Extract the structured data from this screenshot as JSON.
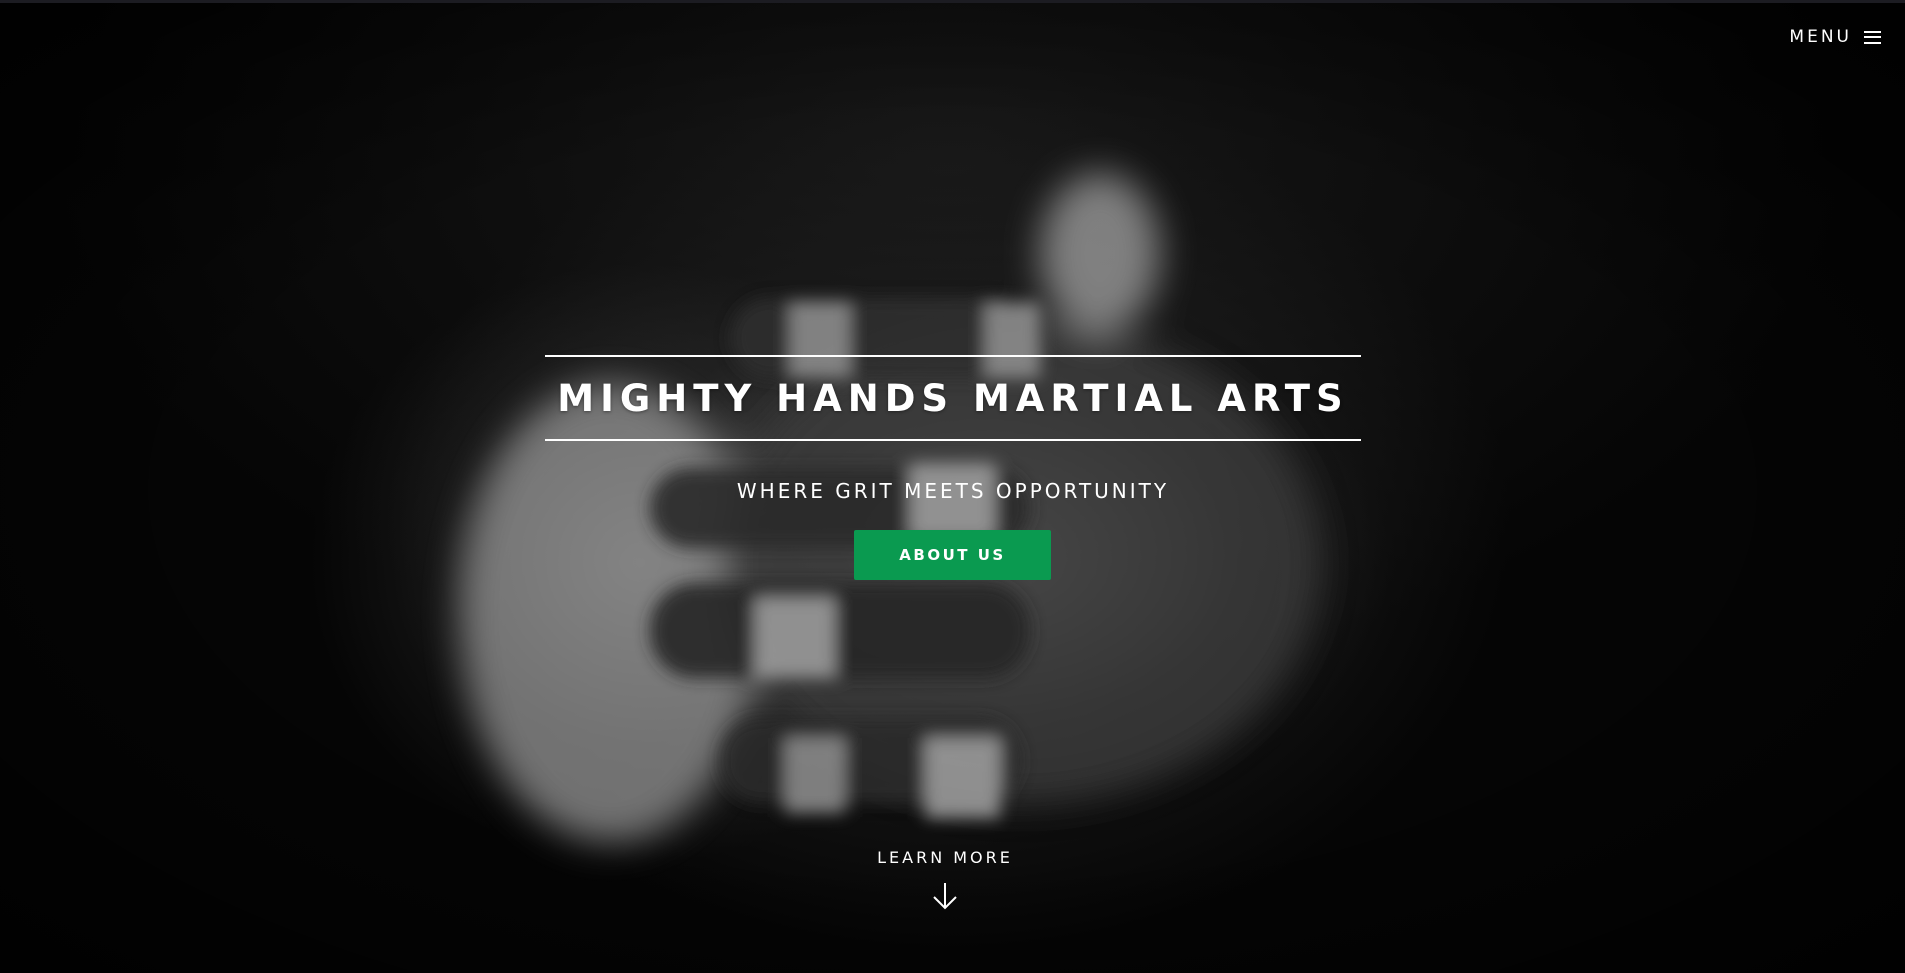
{
  "header": {
    "menu_label": "MENU",
    "menu_icon": "hamburger-icon"
  },
  "hero": {
    "title": "MIGHTY HANDS MARTIAL ARTS",
    "tagline": "WHERE GRIT MEETS OPPORTUNITY",
    "cta_label": "ABOUT US",
    "learn_more_label": "LEARN MORE",
    "learn_more_icon": "arrow-down-icon",
    "background_image": "grayscale photo of taped hands clasped together"
  },
  "colors": {
    "accent": "#0a9a50",
    "text": "#ffffff",
    "background": "#000000"
  }
}
